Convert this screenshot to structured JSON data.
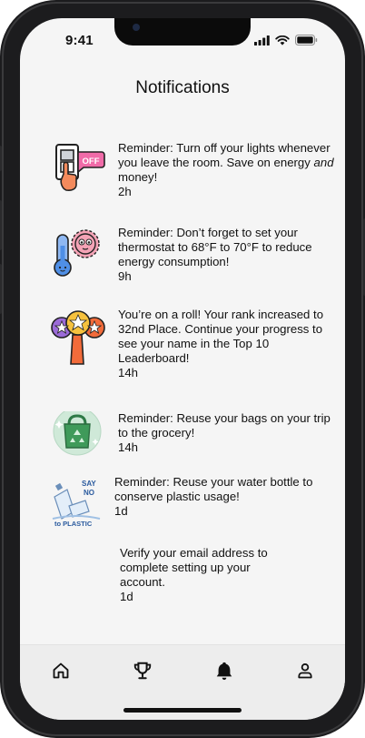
{
  "status_bar": {
    "time": "9:41",
    "icons": [
      "cellular-signal-icon",
      "wifi-icon",
      "battery-icon"
    ]
  },
  "header": {
    "title": "Notifications"
  },
  "notifications": [
    {
      "icon": "light-switch-off-icon",
      "icon_text": "OFF",
      "text_before": "Reminder: Turn off your lights whenever you leave the room. Save on energy ",
      "text_emphasis": "and",
      "text_after": " money!",
      "time": "2h"
    },
    {
      "icon": "thermometer-sun-icon",
      "text": "Reminder: Don’t forget to set your thermostat to 68°F to 70°F to reduce energy consumption!",
      "time": "9h"
    },
    {
      "icon": "leaderboard-stars-icon",
      "text": "You’re on a roll! Your rank increased to 32nd Place. Continue your progress to see your name in the Top 10 Leaderboard!",
      "time": "14h"
    },
    {
      "icon": "reusable-bag-icon",
      "text": "Reminder: Reuse your bags on your trip to the grocery!",
      "time": "14h"
    },
    {
      "icon": "say-no-to-plastic-icon",
      "icon_text": [
        "SAY",
        "NO",
        "to PLASTIC"
      ],
      "text": "Reminder: Reuse your water bottle to conserve plastic usage!",
      "time": "1d"
    },
    {
      "icon": "",
      "text": "Verify your email address to complete setting up your account.",
      "time": "1d"
    }
  ],
  "tab_bar": {
    "items": [
      {
        "name": "home",
        "icon": "home-icon"
      },
      {
        "name": "leaderboard",
        "icon": "trophy-icon"
      },
      {
        "name": "notifications",
        "icon": "bell-icon",
        "active": true
      },
      {
        "name": "profile",
        "icon": "profile-icon"
      }
    ]
  },
  "colors": {
    "screen_bg": "#f5f5f5",
    "tab_bar_bg": "#ededed",
    "frame": "#1c1c1e",
    "pink": "#f06ba8",
    "blue": "#4f8fe6",
    "green": "#3f9a5a",
    "orange": "#f26b3a"
  }
}
